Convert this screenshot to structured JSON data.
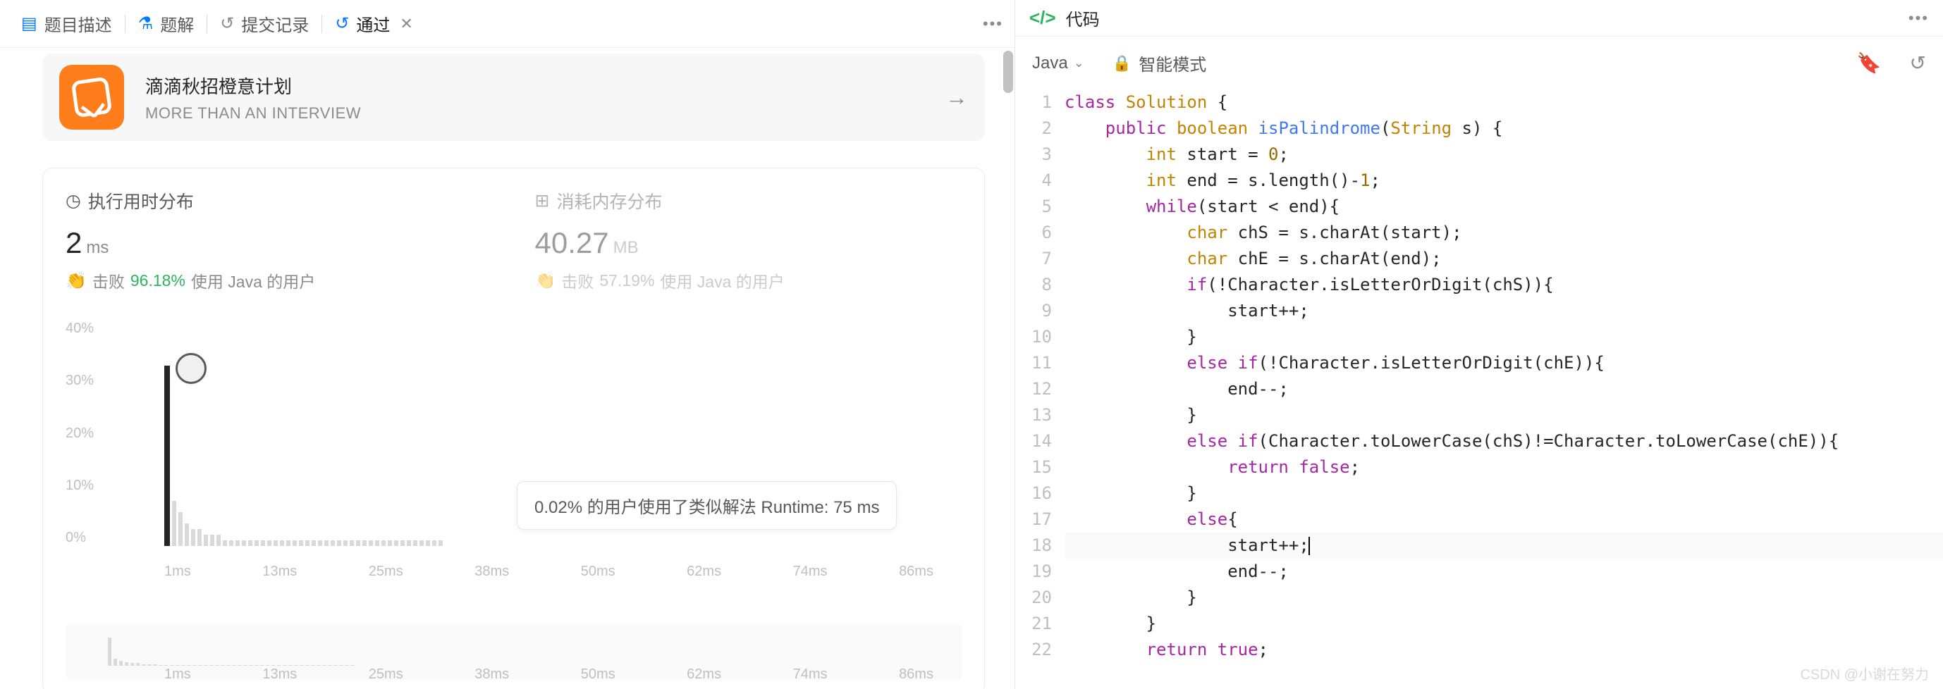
{
  "tabs": {
    "desc": "题目描述",
    "solution": "题解",
    "submissions": "提交记录",
    "pass": "通过"
  },
  "promo": {
    "title": "滴滴秋招橙意计划",
    "subtitle": "MORE THAN AN INTERVIEW"
  },
  "stats": {
    "runtime_title": "执行用时分布",
    "memory_title": "消耗内存分布",
    "runtime_value": "2",
    "runtime_unit": "ms",
    "memory_value": "40.27",
    "memory_unit": "MB",
    "beat_label": "击败",
    "runtime_pct": "96.18%",
    "memory_pct": "57.19%",
    "beat_suffix": "使用 Java 的用户"
  },
  "chart_data": {
    "type": "bar",
    "y_ticks": [
      "40%",
      "30%",
      "20%",
      "10%",
      "0%"
    ],
    "x_ticks": [
      "1ms",
      "13ms",
      "25ms",
      "38ms",
      "50ms",
      "62ms",
      "74ms",
      "86ms"
    ],
    "bars_pct": [
      32,
      8,
      6,
      4,
      3,
      3,
      2,
      2,
      2,
      1,
      1,
      1,
      1,
      1,
      1,
      1,
      1,
      1,
      1,
      1,
      1,
      1,
      1,
      1,
      1,
      1,
      1,
      1,
      1,
      1,
      1,
      1,
      1,
      1,
      1,
      1,
      1,
      1,
      1,
      1,
      1,
      1,
      1,
      1
    ],
    "highlight_index": 0,
    "tooltip": "0.02% 的用户使用了类似解法 Runtime: 75 ms",
    "mini_bars_pct": [
      32,
      8,
      6,
      4,
      3,
      3,
      2,
      2,
      2,
      1,
      1,
      1,
      1,
      1,
      1,
      1,
      1,
      1,
      1,
      1,
      1,
      1,
      1,
      1,
      1,
      1,
      1,
      1,
      1,
      1,
      1,
      1,
      1,
      1,
      1,
      1,
      1,
      1,
      1,
      1,
      1,
      1,
      1,
      1
    ]
  },
  "right": {
    "header": "代码",
    "lang": "Java",
    "mode": "智能模式"
  },
  "code": [
    {
      "n": 1,
      "html": "<span class='kw'>class</span> <span class='cls'>Solution</span> {"
    },
    {
      "n": 2,
      "html": "    <span class='kw'>public</span> <span class='type'>boolean</span> <span class='fn'>isPalindrome</span>(<span class='cls'>String</span> s) {"
    },
    {
      "n": 3,
      "html": "        <span class='type'>int</span> start = <span class='num'>0</span>;"
    },
    {
      "n": 4,
      "html": "        <span class='type'>int</span> end = s.length()-<span class='num'>1</span>;"
    },
    {
      "n": 5,
      "html": "        <span class='kw'>while</span>(start &lt; end){"
    },
    {
      "n": 6,
      "html": "            <span class='type'>char</span> chS = s.charAt(start);"
    },
    {
      "n": 7,
      "html": "            <span class='type'>char</span> chE = s.charAt(end);"
    },
    {
      "n": 8,
      "html": "            <span class='kw'>if</span>(!Character.isLetterOrDigit(chS)){"
    },
    {
      "n": 9,
      "html": "                start++;"
    },
    {
      "n": 10,
      "html": "            }"
    },
    {
      "n": 11,
      "html": "            <span class='kw'>else</span> <span class='kw'>if</span>(!Character.isLetterOrDigit(chE)){"
    },
    {
      "n": 12,
      "html": "                end--;"
    },
    {
      "n": 13,
      "html": "            }"
    },
    {
      "n": 14,
      "html": "            <span class='kw'>else</span> <span class='kw'>if</span>(Character.toLowerCase(chS)!=Character.toLowerCase(chE)){"
    },
    {
      "n": 15,
      "html": "                <span class='kw'>return</span> <span class='bool'>false</span>;"
    },
    {
      "n": 16,
      "html": "            }"
    },
    {
      "n": 17,
      "html": "            <span class='kw'>else</span>{"
    },
    {
      "n": 18,
      "html": "                start++;",
      "cursor": true
    },
    {
      "n": 19,
      "html": "                end--;"
    },
    {
      "n": 20,
      "html": "            }"
    },
    {
      "n": 21,
      "html": "        }"
    },
    {
      "n": 22,
      "html": "        <span class='kw'>return</span> <span class='bool'>true</span>;"
    }
  ],
  "watermark": "CSDN @小谢在努力"
}
